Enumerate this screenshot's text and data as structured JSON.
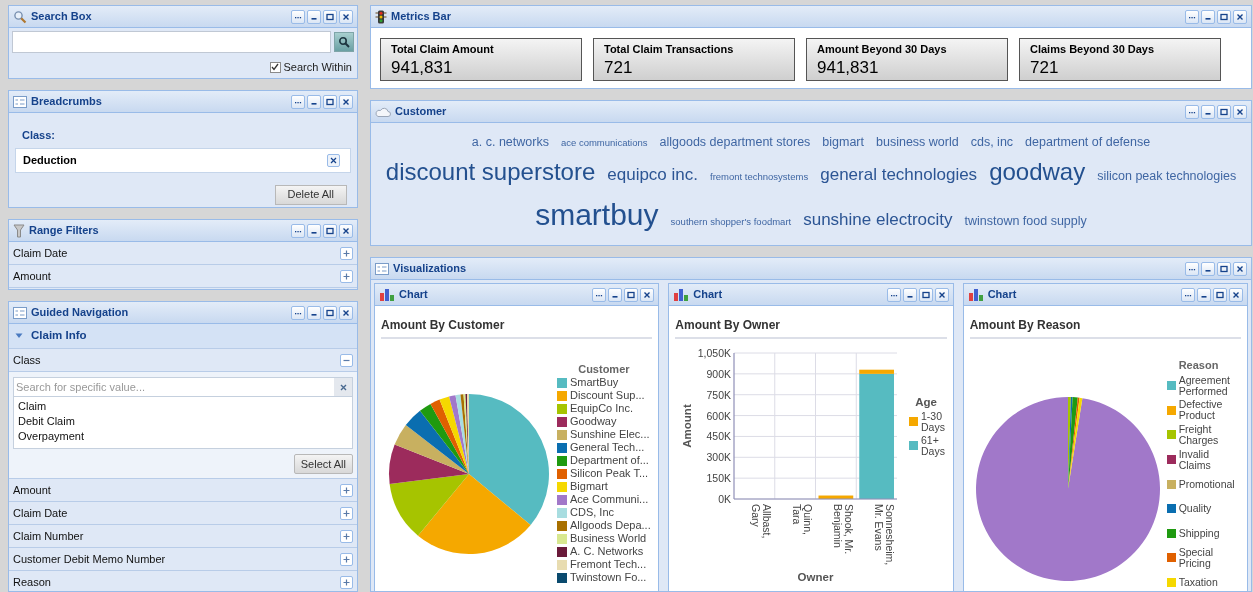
{
  "search_box": {
    "title": "Search Box",
    "search_within": {
      "label": "Search Within",
      "checked": true
    }
  },
  "breadcrumbs": {
    "title": "Breadcrumbs",
    "group_label": "Class:",
    "crumbs": [
      "Deduction"
    ],
    "delete_button": "Delete All"
  },
  "range_filters": {
    "title": "Range Filters",
    "items": [
      {
        "label": "Claim Date",
        "expanded": false
      },
      {
        "label": "Amount",
        "expanded": false
      }
    ]
  },
  "guided_navigation": {
    "title": "Guided Navigation",
    "section": {
      "label": "Claim Info",
      "expanded": true
    },
    "attributes": [
      {
        "label": "Class",
        "expanded": true,
        "search_placeholder": "Search for specific value...",
        "values": [
          "Claim",
          "Debit Claim",
          "Overpayment"
        ],
        "select_all": "Select All"
      },
      {
        "label": "Amount",
        "expanded": false
      },
      {
        "label": "Claim Date",
        "expanded": false
      },
      {
        "label": "Claim Number",
        "expanded": false
      },
      {
        "label": "Customer Debit Memo Number",
        "expanded": false
      },
      {
        "label": "Reason",
        "expanded": false
      }
    ]
  },
  "metrics_bar": {
    "title": "Metrics Bar",
    "metrics": [
      {
        "label": "Total Claim Amount",
        "value": "941,831"
      },
      {
        "label": "Total Claim Transactions",
        "value": "721"
      },
      {
        "label": "Amount Beyond 30 Days",
        "value": "941,831"
      },
      {
        "label": "Claims Beyond 30 Days",
        "value": "721"
      }
    ]
  },
  "customer_cloud": {
    "title": "Customer",
    "lines": [
      [
        {
          "text": "a. c. networks",
          "kind": "medium"
        },
        {
          "text": "ace communications",
          "kind": "tiny"
        },
        {
          "text": "allgoods department stores",
          "kind": "medium"
        },
        {
          "text": "bigmart",
          "kind": "medium"
        },
        {
          "text": "business world",
          "kind": "medium"
        },
        {
          "text": "cds, inc",
          "kind": "medium"
        },
        {
          "text": "department of defense",
          "kind": "medium"
        }
      ],
      [
        {
          "text": "discount superstore",
          "kind": "large"
        },
        {
          "text": "equipco inc.",
          "kind": "big"
        },
        {
          "text": "fremont technosystems",
          "kind": "tiny"
        },
        {
          "text": "general technologies",
          "kind": "big"
        },
        {
          "text": "goodway",
          "kind": "large"
        },
        {
          "text": "silicon peak technologies",
          "kind": "medium"
        }
      ],
      [
        {
          "text": "smartbuy",
          "kind": "huge"
        },
        {
          "text": "southern shopper's foodmart",
          "kind": "tiny"
        },
        {
          "text": "sunshine electrocity",
          "kind": "big"
        },
        {
          "text": "twinstown food supply",
          "kind": "medium"
        }
      ]
    ]
  },
  "visualizations": {
    "title": "Visualizations",
    "charts": [
      {
        "kind": "pie",
        "title": "Chart",
        "heading": "Amount By Customer",
        "legend_title": "Customer",
        "legend": [
          {
            "label": "SmartBuy",
            "color": "#56bbc1"
          },
          {
            "label": "Discount Sup...",
            "color": "#f5a800"
          },
          {
            "label": "EquipCo Inc.",
            "color": "#a6c400"
          },
          {
            "label": "Goodway",
            "color": "#9c2b5c"
          },
          {
            "label": "Sunshine Elec...",
            "color": "#c8b060"
          },
          {
            "label": "General Tech...",
            "color": "#0a6eb0"
          },
          {
            "label": "Department of...",
            "color": "#1f9a10"
          },
          {
            "label": "Silicon Peak T...",
            "color": "#e06000"
          },
          {
            "label": "Bigmart",
            "color": "#f5d800"
          },
          {
            "label": "Ace Communi...",
            "color": "#a178c9"
          },
          {
            "label": "CDS, Inc",
            "color": "#a8dde0"
          },
          {
            "label": "Allgoods Depa...",
            "color": "#a87000"
          },
          {
            "label": "Business World",
            "color": "#d8e890"
          },
          {
            "label": "A. C. Networks",
            "color": "#6a1a3a"
          },
          {
            "label": "Fremont Tech...",
            "color": "#e8dcb0"
          },
          {
            "label": "Twinstown Fo...",
            "color": "#0a4a6e"
          }
        ]
      },
      {
        "title": "Chart",
        "heading": "Amount By Owner",
        "chart_data": {
          "type": "bar",
          "stacked": true,
          "grid": true,
          "legend": {
            "title": "Age"
          },
          "xlabel": "Owner",
          "ylabel": "Amount",
          "categories": [
            "Allbast, Gary",
            "Quinn, Tara",
            "Shook, Mr. Benjamin",
            "Sonnesheim, Mr. Evans"
          ],
          "series": [
            {
              "name": "1-30 Days",
              "color": "#f5a800",
              "values": [
                0,
                0,
                25000,
                30000
              ]
            },
            {
              "name": "61+ Days",
              "color": "#56bbc1",
              "values": [
                0,
                0,
                0,
                900000
              ]
            }
          ],
          "ylim": [
            0,
            1050000
          ],
          "yticks": [
            {
              "value": 0,
              "label": "0K"
            },
            {
              "value": 150000,
              "label": "150K"
            },
            {
              "value": 300000,
              "label": "300K"
            },
            {
              "value": 450000,
              "label": "450K"
            },
            {
              "value": 600000,
              "label": "600K"
            },
            {
              "value": 750000,
              "label": "750K"
            },
            {
              "value": 900000,
              "label": "900K"
            },
            {
              "value": 1050000,
              "label": "1,050K"
            }
          ]
        }
      },
      {
        "kind": "pie",
        "title": "Chart",
        "heading": "Amount By Reason",
        "legend_title": "Reason",
        "legend": [
          {
            "label": "Agreement Performed",
            "color": "#56bbc1"
          },
          {
            "label": "Defective Product",
            "color": "#f5a800"
          },
          {
            "label": "Freight Charges",
            "color": "#a6c400"
          },
          {
            "label": "Invalid Claims",
            "color": "#9c2b5c"
          },
          {
            "label": "Promotional",
            "color": "#c8b060"
          },
          {
            "label": "Quality",
            "color": "#0a6eb0"
          },
          {
            "label": "Shipping",
            "color": "#1f9a10"
          },
          {
            "label": "Special Pricing",
            "color": "#e06000"
          },
          {
            "label": "Taxation",
            "color": "#f5d800"
          }
        ]
      }
    ]
  }
}
